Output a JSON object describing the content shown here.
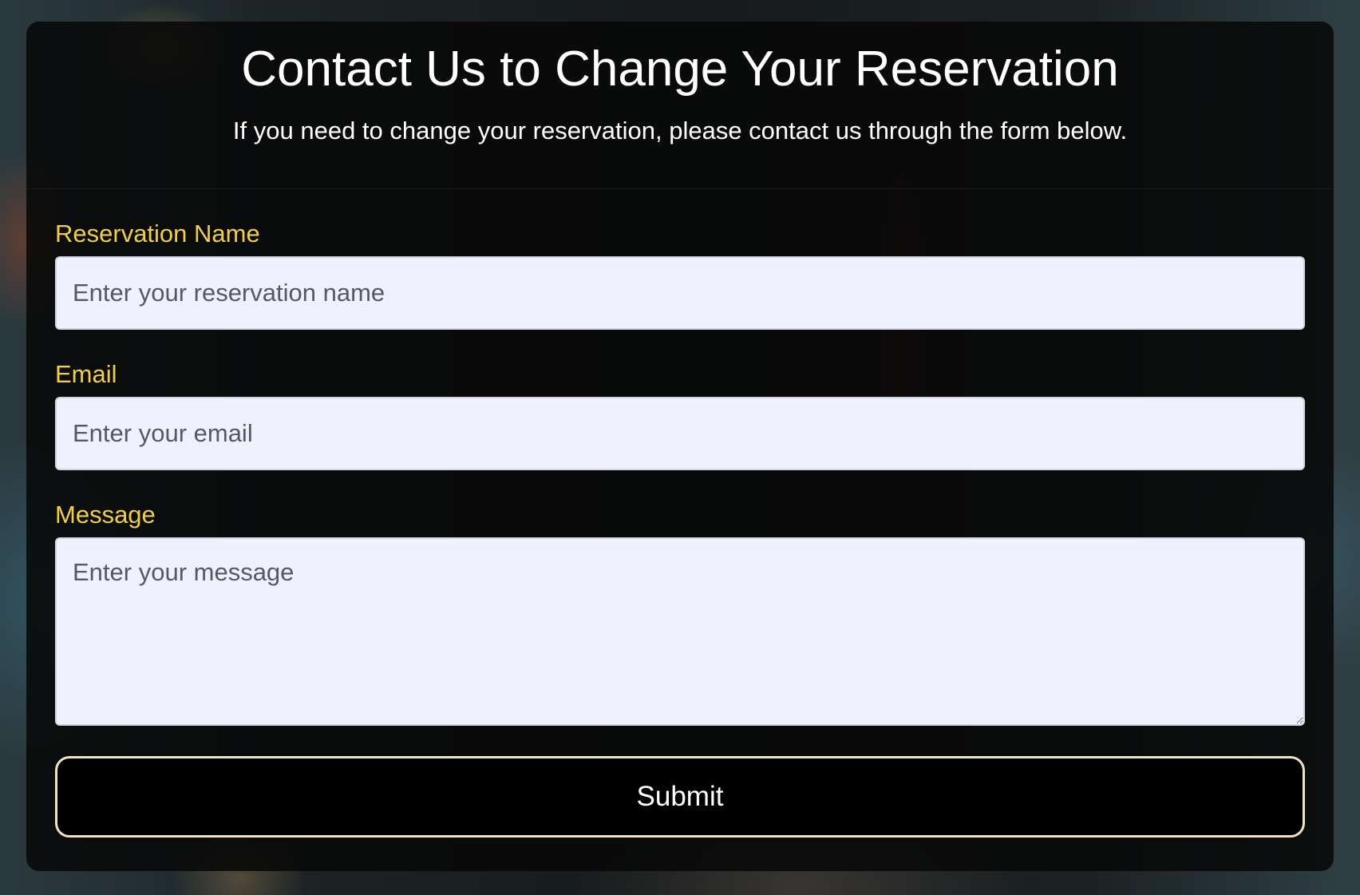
{
  "page": {
    "title": "Contact Us to Change Your Reservation",
    "subtitle": "If you need to change your reservation, please contact us through the form below."
  },
  "form": {
    "name": {
      "label": "Reservation Name",
      "placeholder": "Enter your reservation name",
      "value": ""
    },
    "email": {
      "label": "Email",
      "placeholder": "Enter your email",
      "value": ""
    },
    "message": {
      "label": "Message",
      "placeholder": "Enter your message",
      "value": ""
    },
    "submit_label": "Submit"
  },
  "colors": {
    "label": "#f0ce4a",
    "input_bg": "#eff2fe",
    "button_border": "#efe2c5",
    "card_bg": "#080808"
  }
}
